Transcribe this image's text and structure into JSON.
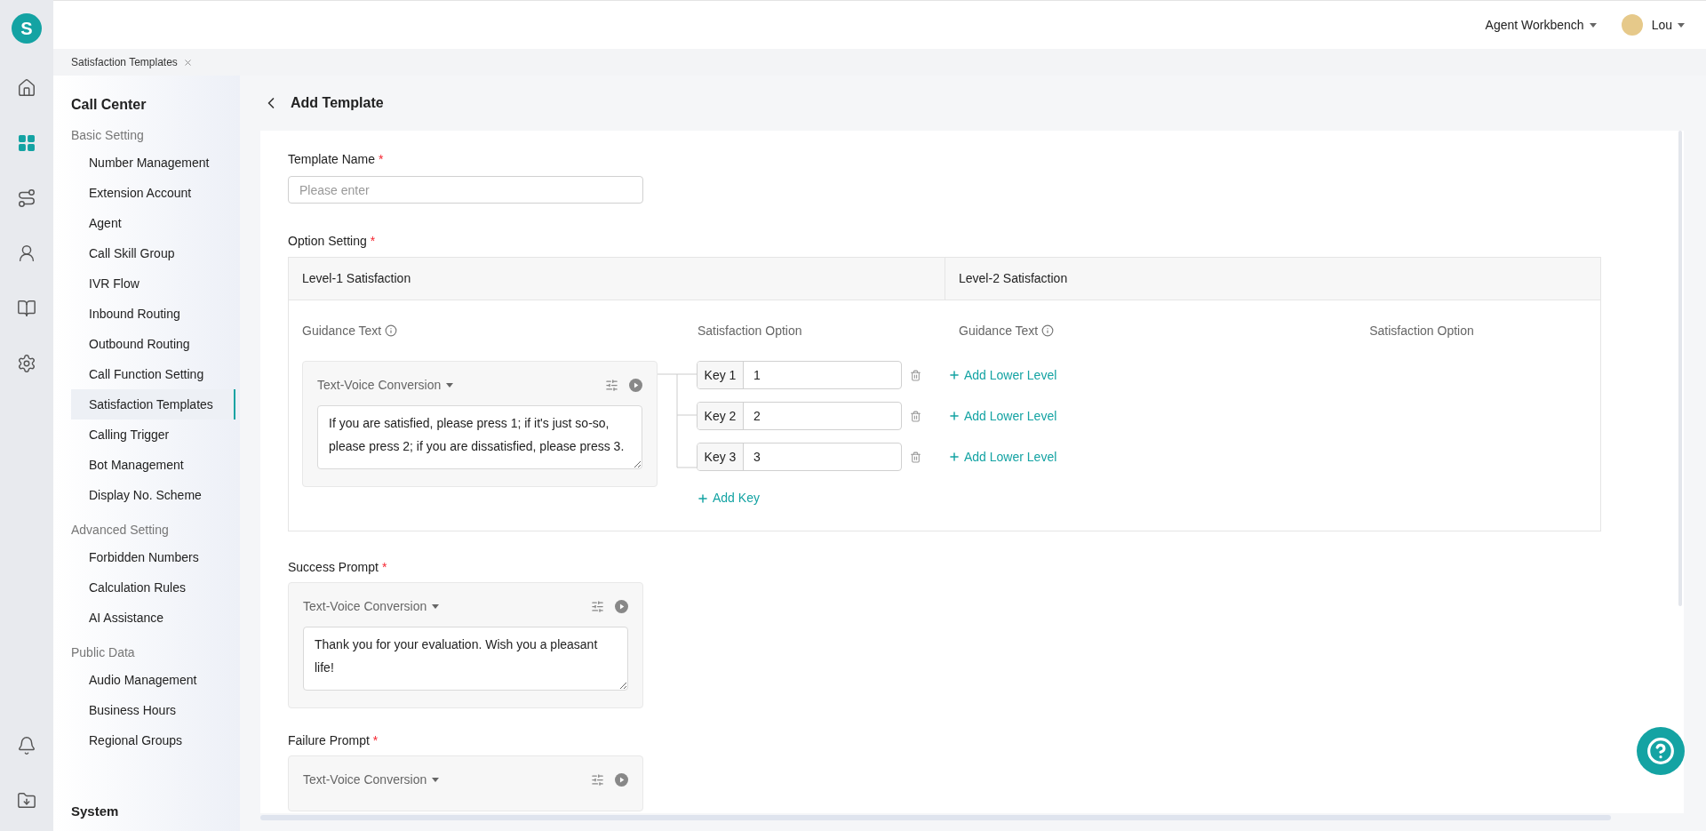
{
  "logo_letter": "S",
  "rail": [
    {
      "kind": "home",
      "selected": false
    },
    {
      "kind": "apps",
      "selected": true
    },
    {
      "kind": "route",
      "selected": false
    },
    {
      "kind": "person",
      "selected": false
    },
    {
      "kind": "book",
      "selected": false
    },
    {
      "kind": "settings",
      "selected": false
    }
  ],
  "rail_bottom": [
    {
      "kind": "bell",
      "selected": false
    },
    {
      "kind": "download",
      "selected": false
    }
  ],
  "header": {
    "workbench": "Agent Workbench",
    "user": "Lou"
  },
  "tabs": [
    {
      "label": "Satisfaction Templates"
    }
  ],
  "sidebar": {
    "title": "Call Center",
    "groups": [
      {
        "title": "Basic Setting",
        "items": [
          {
            "label": "Number Management",
            "selected": false
          },
          {
            "label": "Extension Account",
            "selected": false
          },
          {
            "label": "Agent",
            "selected": false
          },
          {
            "label": "Call Skill Group",
            "selected": false
          },
          {
            "label": "IVR Flow",
            "selected": false
          },
          {
            "label": "Inbound Routing",
            "selected": false
          },
          {
            "label": "Outbound Routing",
            "selected": false
          },
          {
            "label": "Call Function Setting",
            "selected": false
          },
          {
            "label": "Satisfaction Templates",
            "selected": true
          },
          {
            "label": "Calling Trigger",
            "selected": false
          },
          {
            "label": "Bot Management",
            "selected": false
          },
          {
            "label": "Display No. Scheme",
            "selected": false
          }
        ]
      },
      {
        "title": "Advanced Setting",
        "items": [
          {
            "label": "Forbidden Numbers",
            "selected": false
          },
          {
            "label": "Calculation Rules",
            "selected": false
          },
          {
            "label": "AI Assistance",
            "selected": false
          }
        ]
      },
      {
        "title": "Public Data",
        "items": [
          {
            "label": "Audio Management",
            "selected": false
          },
          {
            "label": "Business Hours",
            "selected": false
          },
          {
            "label": "Regional Groups",
            "selected": false
          }
        ]
      }
    ],
    "footer_title": "System"
  },
  "page_title": "Add Template",
  "template_name": {
    "label": "Template Name",
    "required_mark": "*",
    "placeholder": "Please enter"
  },
  "option_setting": {
    "label": "Option Setting",
    "required_mark": "*",
    "columns": [
      "Level-1 Satisfaction",
      "Level-2 Satisfaction"
    ],
    "level1": {
      "guidance_label": "Guidance Text",
      "option_label": "Satisfaction Option",
      "voice": {
        "mode": "Text-Voice Conversion",
        "text": "If you are satisfied, please press 1; if it's just so-so, please press 2; if you are dissatisfied, please press 3."
      },
      "keys": [
        {
          "label": "Key 1",
          "value": "1",
          "action": "Add Lower Level"
        },
        {
          "label": "Key 2",
          "value": "2",
          "action": "Add Lower Level"
        },
        {
          "label": "Key 3",
          "value": "3",
          "action": "Add Lower Level"
        }
      ],
      "add_key": "Add Key"
    },
    "level2": {
      "guidance_label": "Guidance Text",
      "option_label": "Satisfaction Option"
    }
  },
  "success_prompt": {
    "label": "Success Prompt",
    "required_mark": "*",
    "mode": "Text-Voice Conversion",
    "text": "Thank you for your evaluation. Wish you a pleasant life!"
  },
  "failure_prompt": {
    "label": "Failure Prompt",
    "required_mark": "*",
    "mode": "Text-Voice Conversion"
  }
}
